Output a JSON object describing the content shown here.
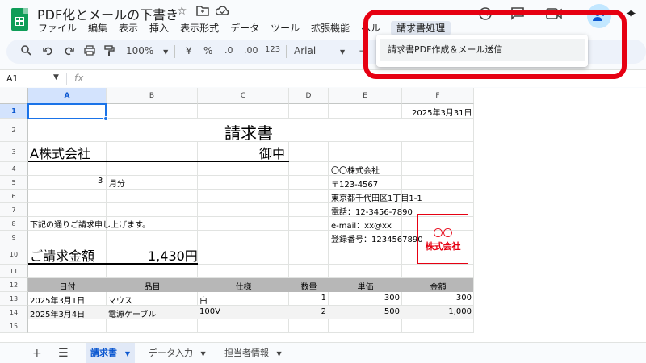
{
  "window": {
    "doc_title": "PDF化とメールの下書き",
    "icons": [
      "star-icon",
      "move-to-folder-icon",
      "cloud-status-icon",
      "history-icon",
      "comment-icon",
      "meet-icon",
      "share-icon",
      "gemini-icon"
    ]
  },
  "menubar": {
    "items": [
      "ファイル",
      "編集",
      "表示",
      "挿入",
      "表示形式",
      "データ",
      "ツール",
      "拡張機能",
      "ヘルプ",
      "請求書処理"
    ]
  },
  "toolbar": {
    "zoom": "100%",
    "currency": "¥",
    "percent": "%",
    "dec_decrease": ".0",
    "dec_increase": ".00",
    "number_format": "123",
    "font": "Arial",
    "minus": "−"
  },
  "formula_bar": {
    "cell_ref": "A1",
    "fx": "fx"
  },
  "dropdown": {
    "item": "請求書PDF作成＆メール送信"
  },
  "columns": [
    "A",
    "B",
    "C",
    "D",
    "E",
    "F"
  ],
  "rows": [
    "1",
    "2",
    "3",
    "4",
    "5",
    "6",
    "7",
    "8",
    "9",
    "10",
    "11",
    "12",
    "13",
    "14",
    "15"
  ],
  "invoice": {
    "date": "2025年3月31日",
    "heading": "請求書",
    "client": "A株式会社",
    "honorific": "御中",
    "month_num": "3",
    "month_unit": "月分",
    "intro": "下記の通りご請求申し上げます。",
    "total_label": "ご請求金額",
    "total_value": "1,430円",
    "issuer": {
      "company": "〇〇株式会社",
      "zip": "〒123-4567",
      "address": "東京都千代田区1丁目1-1",
      "phone": "電話：12-3456-7890",
      "email": "e-mail：xx@xx",
      "reg": "登録番号：1234567890"
    },
    "stamp_line1": "〇〇",
    "stamp_line2": "株式会社",
    "table_headers": [
      "日付",
      "品目",
      "仕様",
      "数量",
      "単価",
      "金額"
    ],
    "items": [
      {
        "date": "2025年3月1日",
        "item": "マウス",
        "spec": "白",
        "qty": "1",
        "price": "300",
        "amount": "300"
      },
      {
        "date": "2025年3月4日",
        "item": "電源ケーブル",
        "spec": "100V",
        "qty": "2",
        "price": "500",
        "amount": "1,000"
      }
    ]
  },
  "bottom": {
    "tabs": [
      "請求書",
      "データ入力",
      "担当者情報"
    ]
  },
  "colors": {
    "accent": "#1a73e8",
    "highlight": "#e60012",
    "header_fill": "#b7b7b7"
  }
}
